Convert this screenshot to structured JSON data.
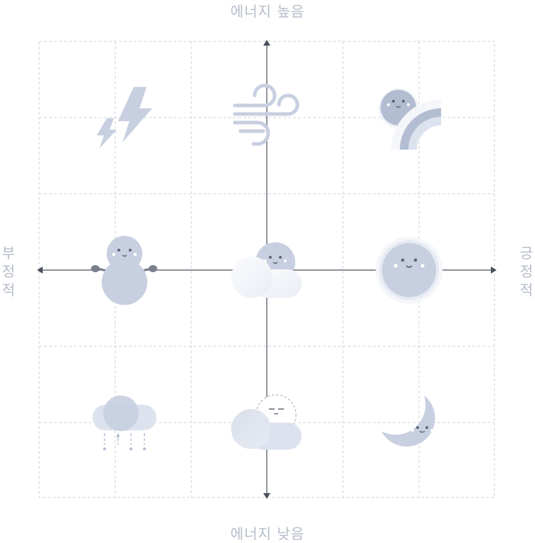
{
  "axes": {
    "top": "에너지 높음",
    "bottom": "에너지 낮음",
    "left": [
      "부",
      "정",
      "적"
    ],
    "right": [
      "긍",
      "정",
      "적"
    ]
  },
  "colors": {
    "icon": "#c7cfe0",
    "icon_dark": "#b3bdd2",
    "icon_light": "#dde3ee",
    "axis": "#4a4f5c",
    "grid": "#cfd3da",
    "face": "#5f6675",
    "cheek": "#ffffff",
    "label": "#b5bcc9"
  },
  "icons": [
    {
      "name": "lightning-icon",
      "row": 0,
      "col": 0
    },
    {
      "name": "wind-icon",
      "row": 0,
      "col": 1
    },
    {
      "name": "sun-rainbow-icon",
      "row": 0,
      "col": 2
    },
    {
      "name": "snowman-icon",
      "row": 1,
      "col": 0
    },
    {
      "name": "sun-behind-cloud-icon",
      "row": 1,
      "col": 1
    },
    {
      "name": "sun-icon",
      "row": 1,
      "col": 2
    },
    {
      "name": "rain-cloud-icon",
      "row": 2,
      "col": 0
    },
    {
      "name": "cloud-dashed-sun-icon",
      "row": 2,
      "col": 1
    },
    {
      "name": "crescent-moon-icon",
      "row": 2,
      "col": 2
    }
  ]
}
